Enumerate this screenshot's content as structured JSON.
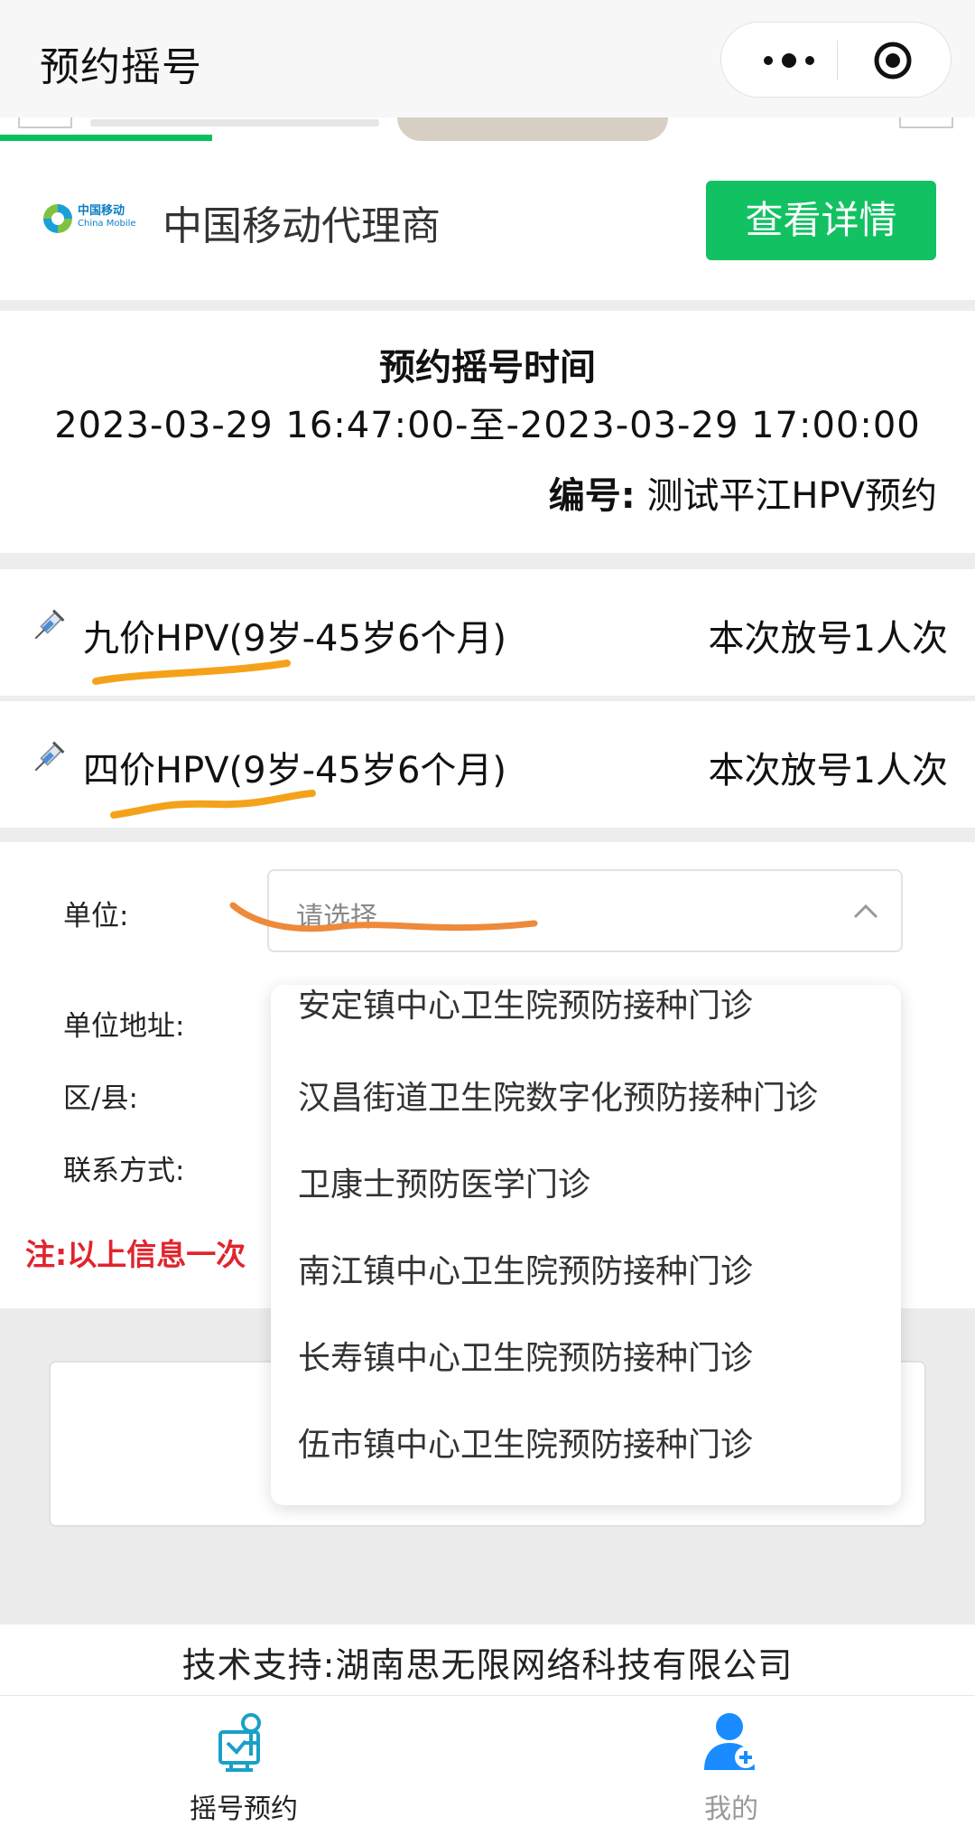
{
  "nav": {
    "title": "预约摇号"
  },
  "carrier": {
    "logo_cn": "中国移动",
    "logo_en": "China Mobile",
    "name": "中国移动代理商",
    "detail_button": "查看详情"
  },
  "schedule": {
    "title": "预约摇号时间",
    "range": "2023-03-29 16:47:00-至-2023-03-29 17:00:00",
    "code_label": "编号:",
    "code_value": "测试平江HPV预约"
  },
  "vaccines": [
    {
      "name": "九价HPV(9岁-45岁6个月)",
      "count": "本次放号1人次"
    },
    {
      "name": "四价HPV(9岁-45岁6个月)",
      "count": "本次放号1人次"
    }
  ],
  "form": {
    "unit_label": "单位:",
    "unit_placeholder": "请选择",
    "address_label": "单位地址:",
    "district_label": "区/县:",
    "contact_label": "联系方式:",
    "note": "注:以上信息一次"
  },
  "dropdown": {
    "options": [
      "安定镇中心卫生院预防接种门诊",
      "汉昌街道卫生院数字化预防接种门诊",
      "卫康士预防医学门诊",
      "南江镇中心卫生院预防接种门诊",
      "长寿镇中心卫生院预防接种门诊",
      "伍市镇中心卫生院预防接种门诊"
    ]
  },
  "footer": {
    "support": "技术支持:湖南思无限网络科技有限公司"
  },
  "tabbar": {
    "items": [
      {
        "label": "摇号预约",
        "icon": "lottery-reserve-icon"
      },
      {
        "label": "我的",
        "icon": "user-add-icon"
      }
    ]
  },
  "colors": {
    "primary_green": "#12c161",
    "note_red": "#e0242d",
    "tab_blue": "#1a8cff",
    "annotation_orange": "#f4a21a"
  }
}
